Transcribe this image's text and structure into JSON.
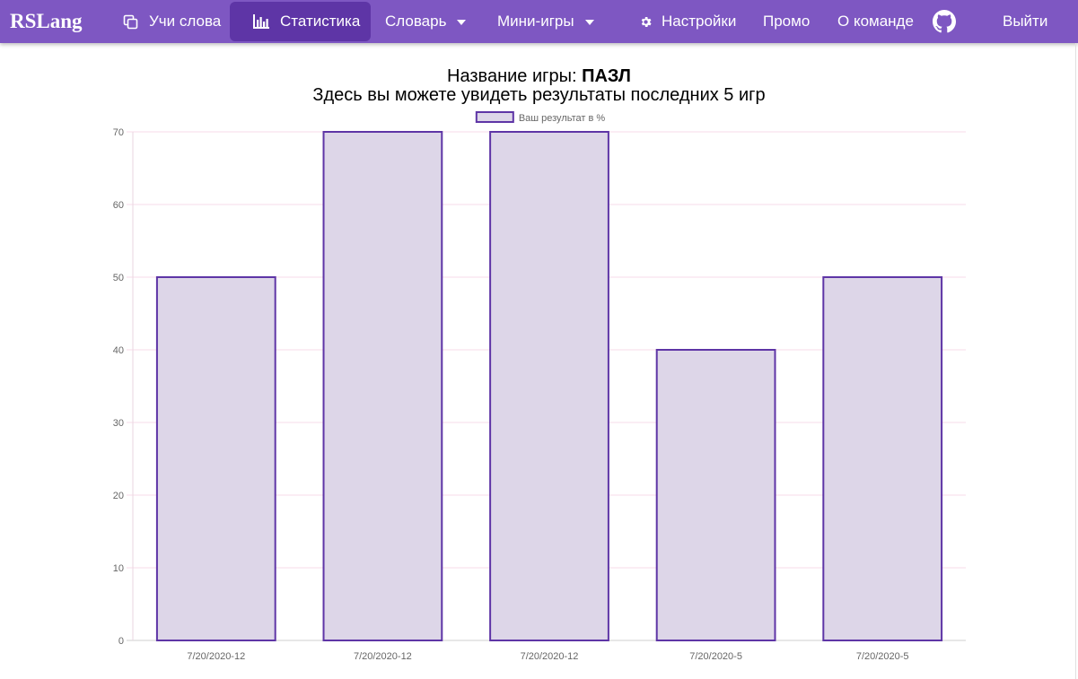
{
  "brand": "RSLang",
  "nav": {
    "learn": "Учи слова",
    "stats": "Статистика",
    "dictionary": "Словарь",
    "minigames": "Мини-игры",
    "settings": "Настройки",
    "promo": "Промо",
    "team": "О команде",
    "logout": "Выйти"
  },
  "icons": {
    "learn": "copy-icon",
    "stats": "bar-chart-icon",
    "settings": "gear-icon",
    "github": "github-icon"
  },
  "colors": {
    "navbar": "#7e57c2",
    "active_tab": "#5e35a6",
    "bar_fill": "#ddd6e8",
    "bar_border": "#5e35a6",
    "gridline": "#f7dbe8"
  },
  "header": {
    "game_label": "Название игры: ",
    "game_name": "ПАЗЛ",
    "subtitle": "Здесь вы можете увидеть результаты последних 5 игр"
  },
  "chart_data": {
    "type": "bar",
    "categories": [
      "7/20/2020-12",
      "7/20/2020-12",
      "7/20/2020-12",
      "7/20/2020-5",
      "7/20/2020-5"
    ],
    "series": [
      {
        "name": "Ваш результат в %",
        "values": [
          50,
          70,
          70,
          40,
          50
        ]
      }
    ],
    "ylim": [
      0,
      70
    ],
    "yticks": [
      0,
      10,
      20,
      30,
      40,
      50,
      60,
      70
    ],
    "legend": "top-center",
    "grid": true
  }
}
